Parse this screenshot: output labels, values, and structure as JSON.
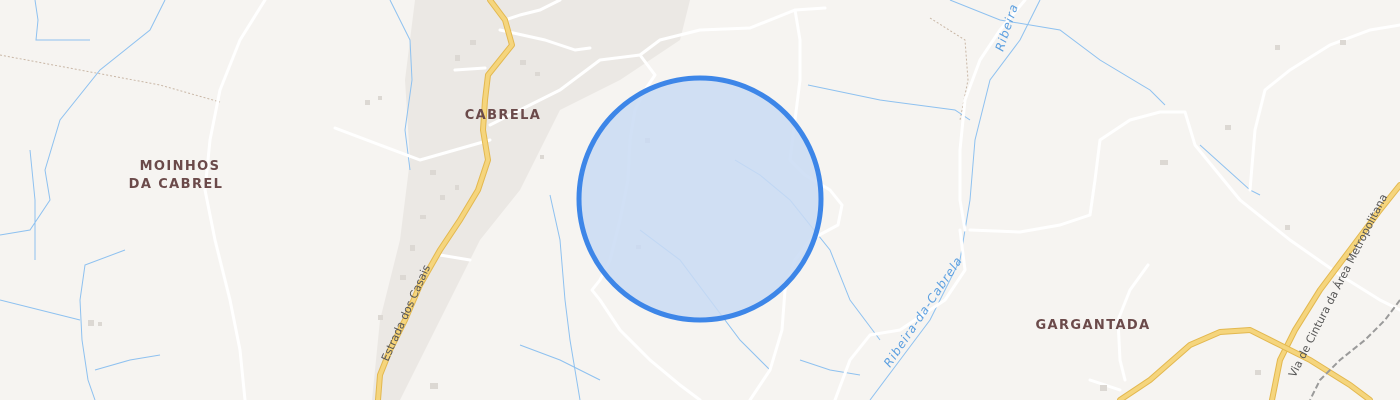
{
  "map": {
    "places": {
      "moinhos_line1": "MOINHOS",
      "moinhos_line2": "DA CABREL",
      "cabrela": "CABRELA",
      "gargantada": "GARGANTADA"
    },
    "waterways": {
      "top": "Ribeira",
      "bottom": "Ribeira-da-Cabrela"
    },
    "roads": {
      "estrada": "Estrada dos Casais",
      "via": "Via de Cintura da Área Metropolitana"
    },
    "marker": {
      "fill": "#c9dbf3",
      "stroke": "#3d86e8"
    },
    "colors": {
      "land": "#f6f4f1",
      "settlement": "#ebe8e4",
      "road_major": "#f3cf73",
      "road_minor": "#ffffff",
      "water": "#8ec1f0",
      "rail": "#9a9a9a"
    }
  }
}
